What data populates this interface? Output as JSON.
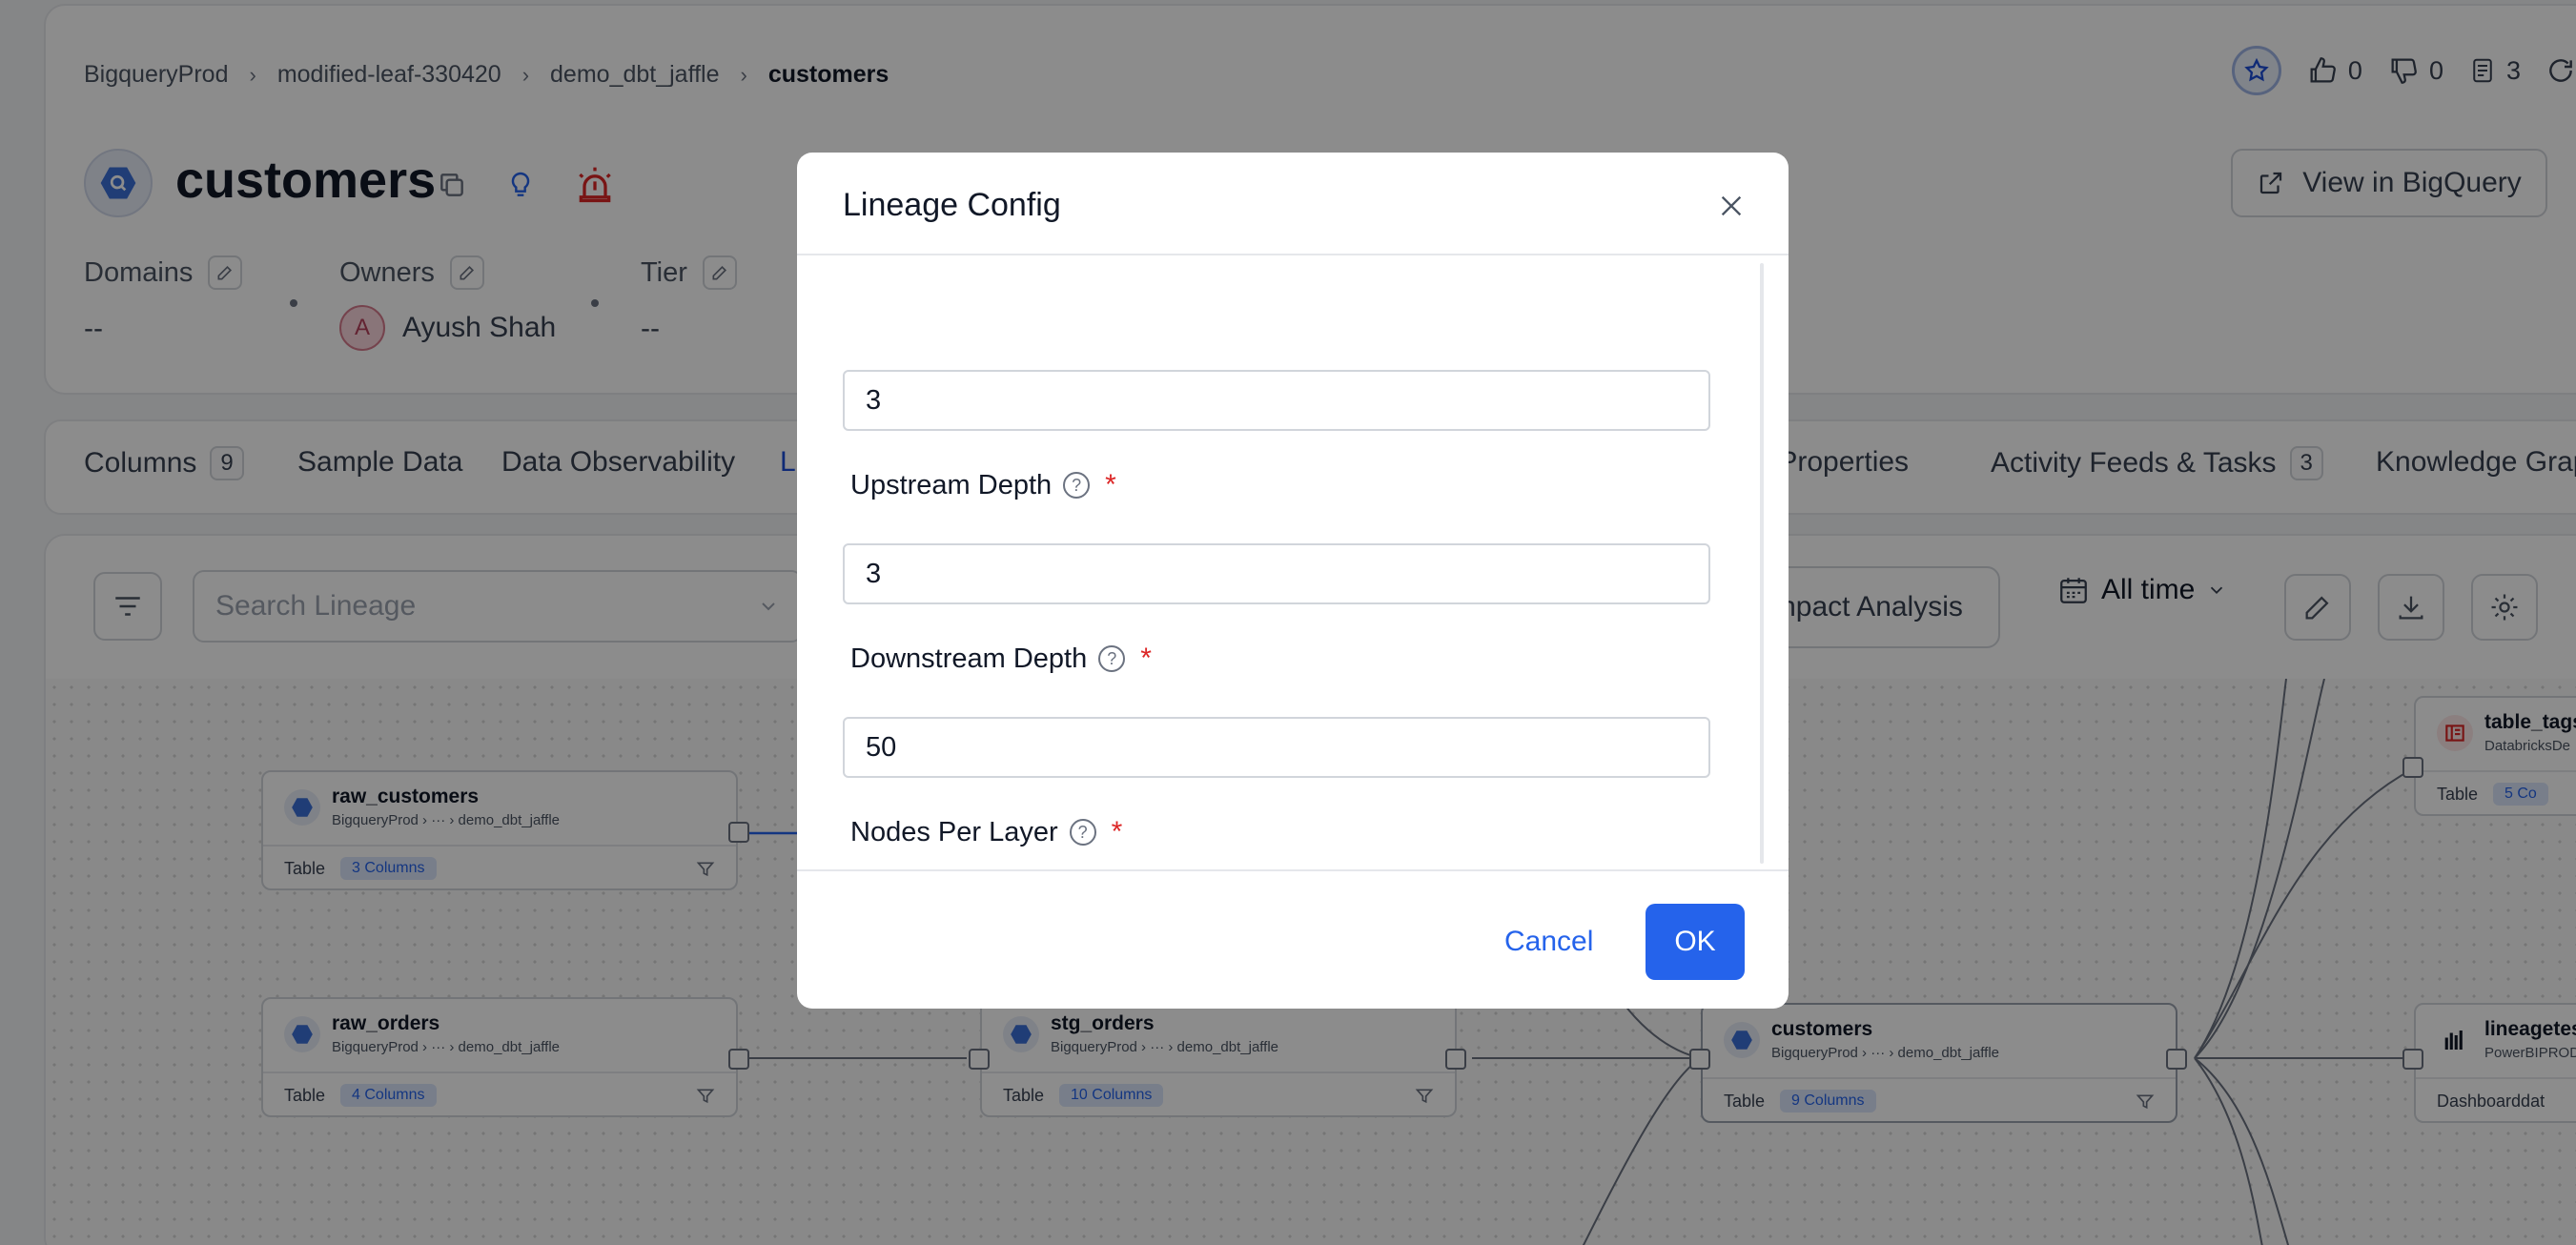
{
  "breadcrumb": {
    "items": [
      "BigqueryProd",
      "modified-leaf-330420",
      "demo_dbt_jaffle"
    ],
    "current": "customers"
  },
  "header": {
    "title": "customers",
    "likes": "0",
    "dislikes": "0",
    "tasks": "3",
    "view_button": "View in BigQuery"
  },
  "meta": {
    "domains_label": "Domains",
    "domains_value": "--",
    "owners_label": "Owners",
    "owner_initial": "A",
    "owner_name": "Ayush Shah",
    "tier_label": "Tier",
    "tier_value": "--"
  },
  "tabs": [
    {
      "label": "Columns",
      "count": "9"
    },
    {
      "label": "Sample Data"
    },
    {
      "label": "Data Observability"
    },
    {
      "label": "L"
    },
    {
      "label": "m Properties"
    },
    {
      "label": "Activity Feeds & Tasks",
      "count": "3"
    },
    {
      "label": "Knowledge Grap"
    }
  ],
  "lineage_toolbar": {
    "search_placeholder": "Search Lineage",
    "impact_label": "npact Analysis",
    "time_label": "All time"
  },
  "nodes": [
    {
      "name": "raw_customers",
      "path_root": "BigqueryProd",
      "path_leaf": "demo_dbt_jaffle",
      "type": "Table",
      "columns": "3 Columns"
    },
    {
      "name": "raw_orders",
      "path_root": "BigqueryProd",
      "path_leaf": "demo_dbt_jaffle",
      "type": "Table",
      "columns": "4 Columns"
    },
    {
      "name": "stg_orders",
      "path_root": "BigqueryProd",
      "path_leaf": "demo_dbt_jaffle",
      "type": "Table",
      "columns": "10 Columns"
    },
    {
      "name": "customers",
      "path_root": "BigqueryProd",
      "path_leaf": "demo_dbt_jaffle",
      "type": "Table",
      "columns": "9 Columns"
    },
    {
      "name": "table_tags",
      "path_root": "DatabricksDe",
      "type": "Table",
      "columns": "5 Co"
    },
    {
      "name": "lineagetes",
      "path_root": "PowerBIPROD",
      "type": "Dashboarddat"
    }
  ],
  "modal": {
    "title": "Lineage Config",
    "fields": [
      {
        "label": "Upstream Depth",
        "value": "3"
      },
      {
        "label": "Downstream Depth",
        "value": "3"
      },
      {
        "label": "Nodes Per Layer",
        "value": "50"
      }
    ],
    "cancel_label": "Cancel",
    "ok_label": "OK"
  },
  "colors": {
    "primary": "#2563eb",
    "required": "#dc2626",
    "alert": "#dc2626"
  }
}
